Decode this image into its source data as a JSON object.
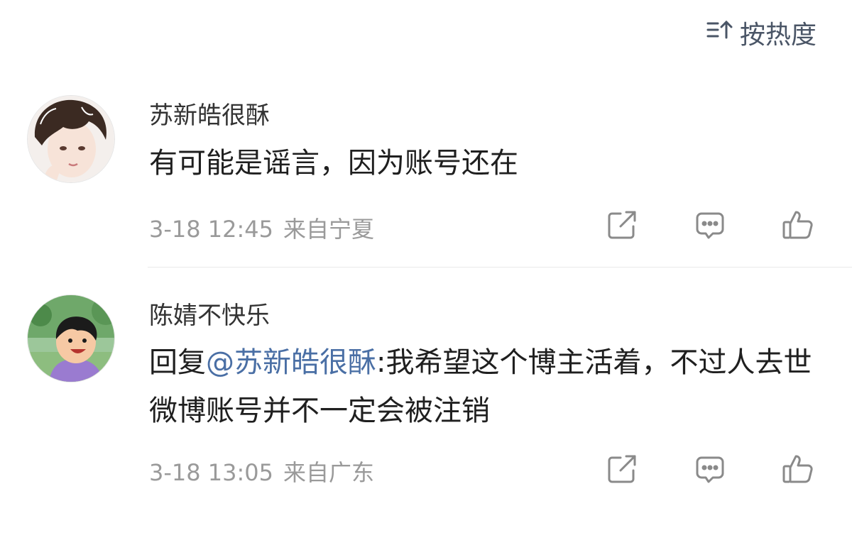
{
  "sort": {
    "label": "按热度",
    "icon": "sort-icon"
  },
  "comments": [
    {
      "username": "苏新皓很酥",
      "text": "有可能是谣言，因为账号还在",
      "date": "3-18 12:45",
      "location": "来自宁夏",
      "avatar": "avatar-anime-boy"
    },
    {
      "username": "陈婧不快乐",
      "reply_prefix": "回复",
      "mention": "@苏新皓很酥",
      "text_body": ":我希望这个博主活着，不过人去世微博账号并不一定会被注销",
      "date": "3-18 13:05",
      "location": "来自广东",
      "avatar": "avatar-cartoon-boy"
    }
  ],
  "actions": [
    "share-icon",
    "comment-icon",
    "like-icon"
  ],
  "colors": {
    "mention": "#4a6fa5",
    "meta": "#9a9a9a",
    "icon": "#8a8a8a",
    "sort": "#4a5566"
  }
}
